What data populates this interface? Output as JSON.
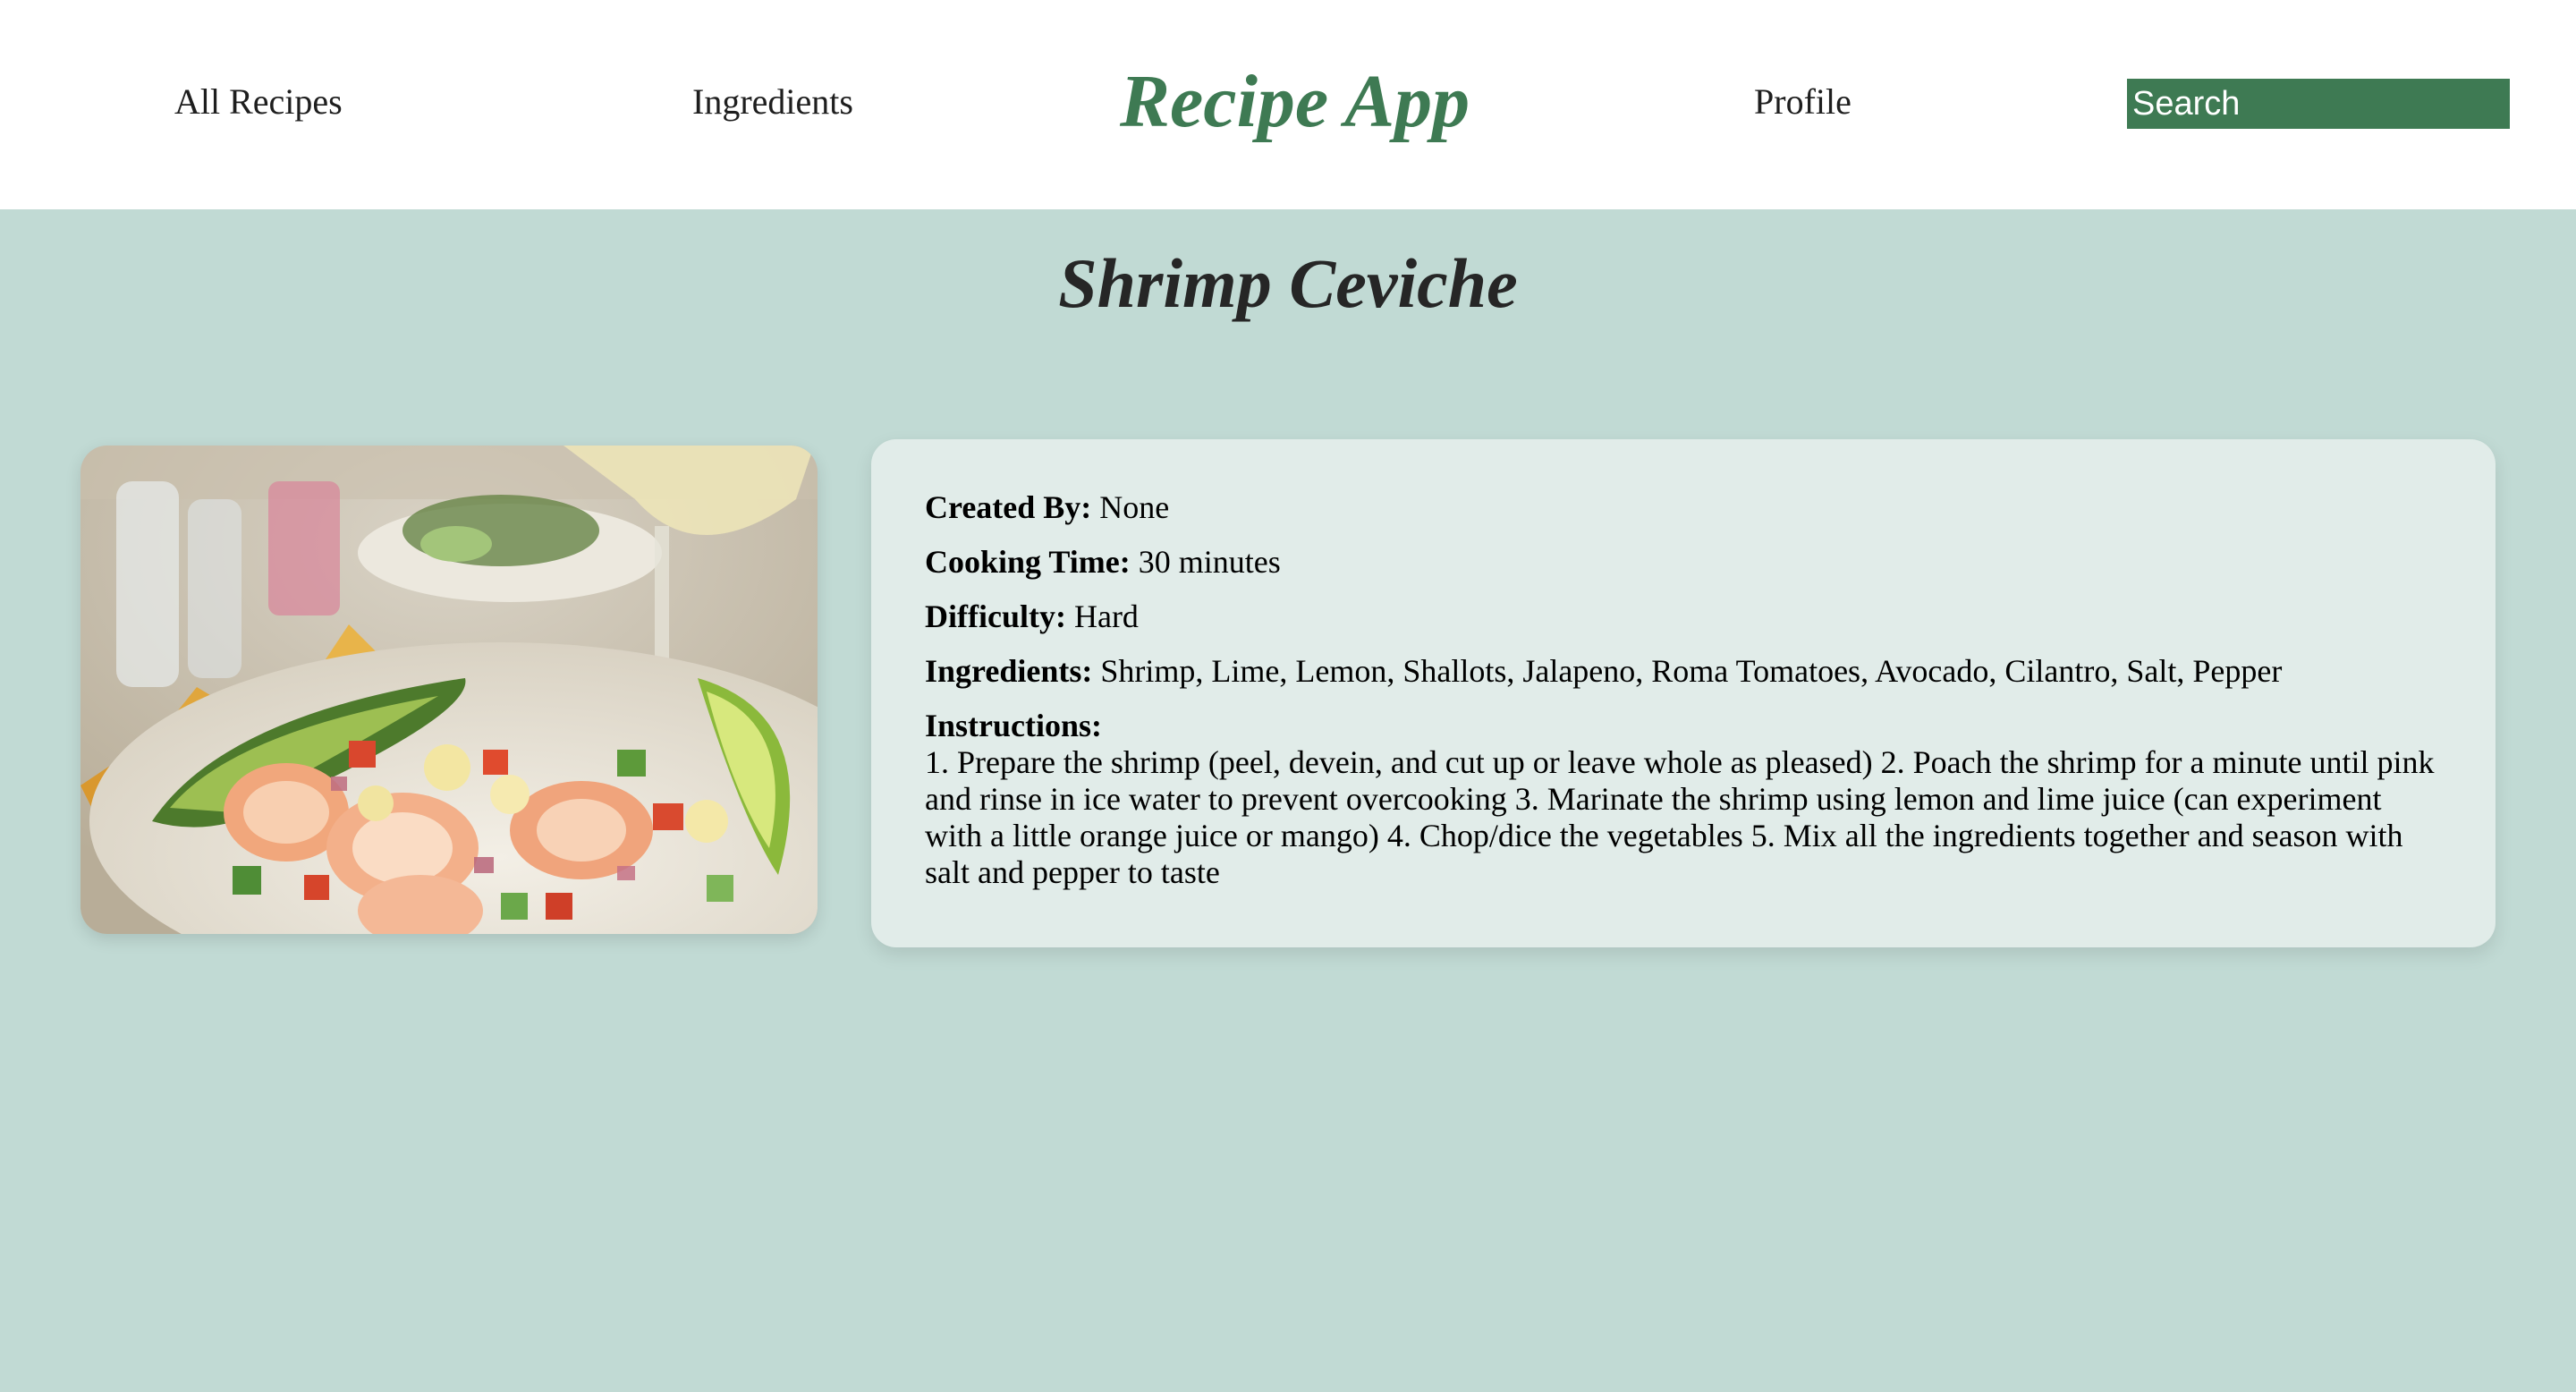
{
  "nav": {
    "all_recipes": "All Recipes",
    "ingredients": "Ingredients",
    "brand": "Recipe App",
    "profile": "Profile",
    "search_placeholder": "Search"
  },
  "recipe": {
    "title": "Shrimp Ceviche",
    "image_icon": "recipe-photo",
    "created_by_label": "Created By:",
    "created_by": "None",
    "cooking_time_label": "Cooking Time:",
    "cooking_time": "30 minutes",
    "difficulty_label": "Difficulty:",
    "difficulty": "Hard",
    "ingredients_label": "Ingredients:",
    "ingredients": "Shrimp, Lime, Lemon, Shallots, Jalapeno, Roma Tomatoes, Avocado, Cilantro, Salt, Pepper",
    "instructions_label": "Instructions:",
    "instructions": "1. Prepare the shrimp (peel, devein, and cut up or leave whole as pleased) 2. Poach the shrimp for a minute until pink and rinse in ice water to prevent overcooking 3. Marinate the shrimp using lemon and lime juice (can experiment with a little orange juice or mango) 4. Chop/dice the vegetables 5. Mix all the ingredients together and season with salt and pepper to taste"
  },
  "colors": {
    "accent": "#3e7a53",
    "background": "#c1dad4",
    "card": "#e1ece9",
    "header": "#ffffff"
  }
}
